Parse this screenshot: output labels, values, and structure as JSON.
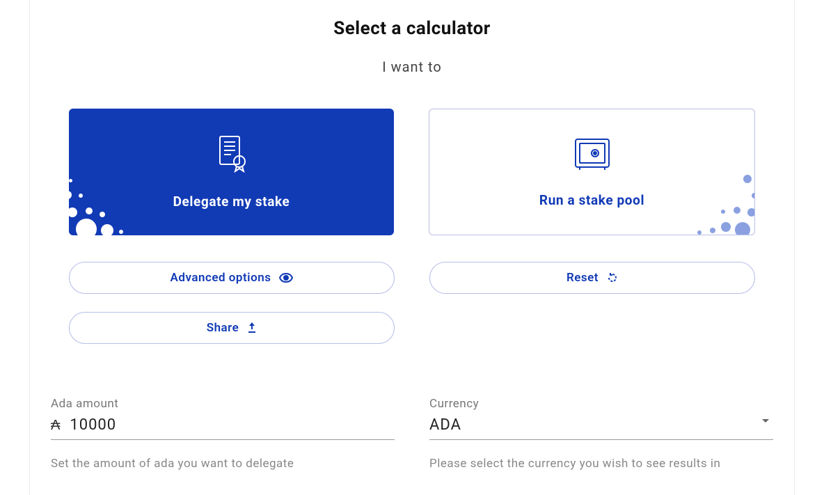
{
  "heading": "Select a calculator",
  "subheading": "I want to",
  "cards": {
    "delegate": {
      "label": "Delegate my stake",
      "icon": "certificate-icon"
    },
    "pool": {
      "label": "Run a stake pool",
      "icon": "safe-icon"
    }
  },
  "buttons": {
    "advanced": "Advanced options",
    "reset": "Reset",
    "share": "Share"
  },
  "form": {
    "amount": {
      "label": "Ada amount",
      "symbol": "₳",
      "value": "10000",
      "help": "Set the amount of ada you want to delegate"
    },
    "currency": {
      "label": "Currency",
      "value": "ADA",
      "help": "Please select the currency you wish to see results in"
    }
  },
  "colors": {
    "primary": "#113ab5",
    "border": "#b9bfe9"
  }
}
